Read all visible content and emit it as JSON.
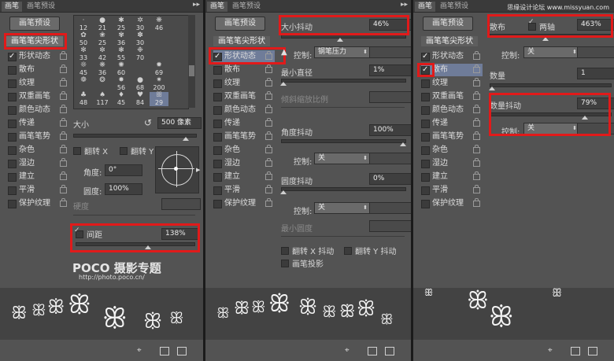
{
  "panel_tabs": {
    "brush": "画笔",
    "brush_presets": "画笔预设",
    "menu": "▸▸"
  },
  "preset_button": "画笔预设",
  "sidebar": {
    "head": "画笔笔尖形状",
    "items": [
      "形状动态",
      "散布",
      "纹理",
      "双重画笔",
      "颜色动态",
      "传递",
      "画笔笔势",
      "杂色",
      "湿边",
      "建立",
      "平滑",
      "保护纹理"
    ]
  },
  "tip_grid": {
    "row1": [
      "12",
      "21",
      "25",
      "30",
      "46",
      ""
    ],
    "row2": [
      "50",
      "25",
      "36",
      "30",
      "",
      ""
    ],
    "row3": [
      "33",
      "42",
      "55",
      "70",
      "",
      ""
    ],
    "row4": [
      "45",
      "36",
      "60",
      "",
      "",
      "69"
    ],
    "row5": [
      "",
      "",
      "56",
      "68",
      "200",
      ""
    ],
    "row6": [
      "48",
      "117",
      "45",
      "84",
      "29",
      ""
    ]
  },
  "panel1": {
    "size_label": "大小",
    "size_value": "500 像素",
    "flip_x": "翻转 X",
    "flip_y": "翻转 Y",
    "angle_label": "角度:",
    "angle_value": "0°",
    "roundness_label": "圆度:",
    "roundness_value": "100%",
    "hardness_label": "硬度",
    "spacing_label": "间距",
    "spacing_value": "138%",
    "watermark_logo": "POCO 摄影专题",
    "watermark_url": "http://photo.poco.cn/"
  },
  "panel2": {
    "size_jitter_label": "大小抖动",
    "size_jitter_value": "46%",
    "control_label": "控制:",
    "control_value": "钢笔压力",
    "min_diameter_label": "最小直径",
    "min_diameter_value": "1%",
    "tilt_scale_label": "倾斜缩放比例",
    "angle_jitter_label": "角度抖动",
    "angle_jitter_value": "100%",
    "angle_control_value": "关",
    "roundness_jitter_label": "圆度抖动",
    "roundness_jitter_value": "0%",
    "roundness_control_value": "关",
    "min_roundness_label": "最小圆度",
    "flip_x_jitter": "翻转 X 抖动",
    "flip_y_jitter": "翻转 Y 抖动",
    "brush_projection": "画笔投影"
  },
  "panel3": {
    "scatter_label": "散布",
    "both_axes_label": "两轴",
    "scatter_value": "463%",
    "control_label": "控制:",
    "control_value": "关",
    "count_label": "数量",
    "count_value": "1",
    "count_jitter_label": "数量抖动",
    "count_jitter_value": "79%",
    "count_control_value": "关",
    "watermark_top": "思缘设计论坛 www.missyuan.com"
  },
  "highlight_color": "#e11a1a",
  "selected_row_color": "#6f7c99"
}
